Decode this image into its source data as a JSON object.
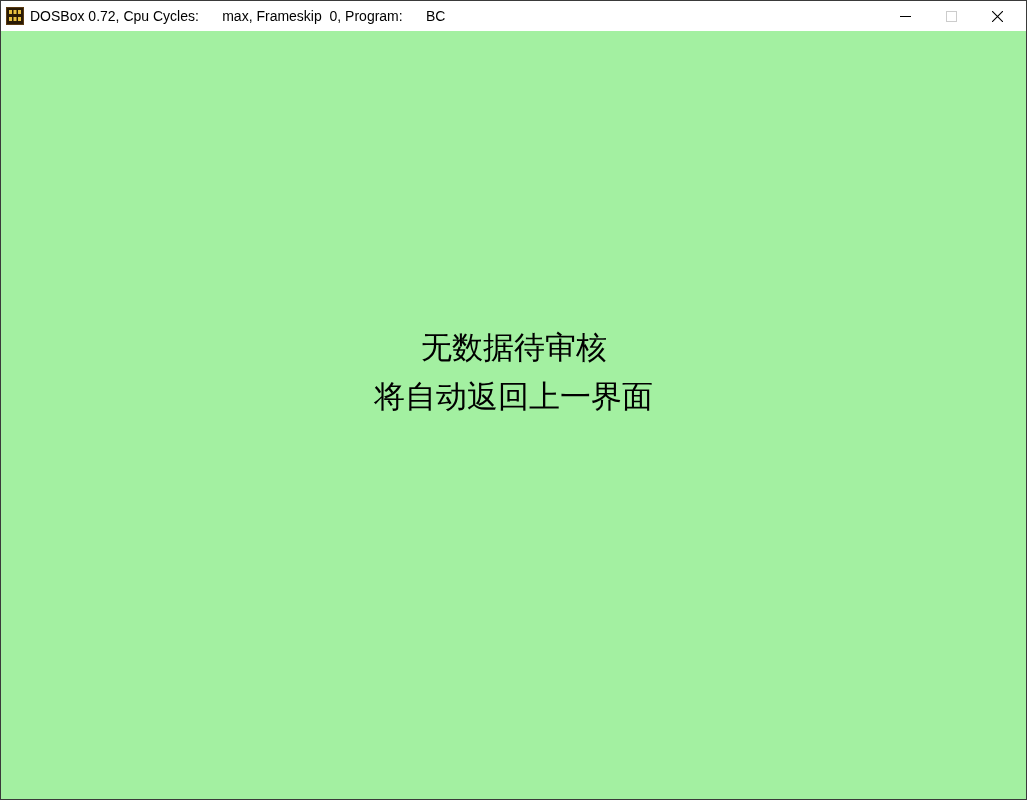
{
  "window": {
    "title": "DOSBox 0.72, Cpu Cycles:      max, Frameskip  0, Program:      BC",
    "maximize_disabled": true
  },
  "screen": {
    "lines": [
      "无数据待审核",
      "将自动返回上一界面"
    ]
  }
}
